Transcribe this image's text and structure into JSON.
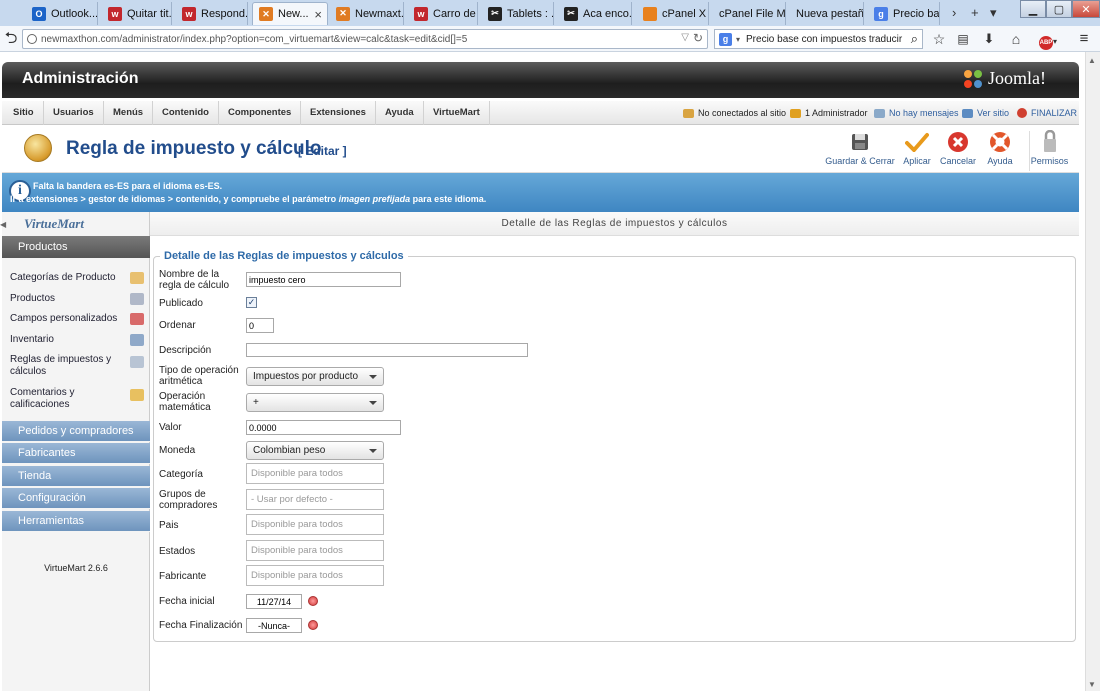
{
  "browser": {
    "tabs": [
      {
        "label": "Outlook...",
        "icon": "outlook-icon",
        "color": "#1c64c8",
        "glyph": "O"
      },
      {
        "label": "Quitar tit...",
        "icon": "bookmark-icon",
        "color": "#c2272d",
        "glyph": "w"
      },
      {
        "label": "Respond...",
        "icon": "bookmark-icon",
        "color": "#c2272d",
        "glyph": "w"
      },
      {
        "label": "New...",
        "icon": "joomla-icon",
        "color": "#e07b22",
        "glyph": "✕",
        "active": true
      },
      {
        "label": "Newmaxt...",
        "icon": "joomla-icon",
        "color": "#e07b22",
        "glyph": "✕"
      },
      {
        "label": "Carro de ...",
        "icon": "bookmark-icon",
        "color": "#c2272d",
        "glyph": "w"
      },
      {
        "label": "Tablets : ...",
        "icon": "scissors-icon",
        "color": "#222",
        "glyph": "✂"
      },
      {
        "label": "Aca enco...",
        "icon": "scissors-icon",
        "color": "#222",
        "glyph": "✂"
      },
      {
        "label": "cPanel X ...",
        "icon": "cpanel-icon",
        "color": "#e8811e",
        "glyph": ""
      },
      {
        "label": "cPanel File M...",
        "icon": "",
        "color": "",
        "glyph": ""
      },
      {
        "label": "Nueva pestaña",
        "icon": "",
        "color": "",
        "glyph": ""
      },
      {
        "label": "Precio ba...",
        "icon": "google-icon",
        "color": "#4a7fe8",
        "glyph": "g"
      }
    ],
    "url": "newmaxthon.com/administrator/index.php?option=com_virtuemart&view=calc&task=edit&cid[]=5",
    "url_host": "newmaxthon.com",
    "search": "Precio base con impuestos traducir"
  },
  "admin": {
    "title": "Administración",
    "logo": "Joomla!",
    "menu": [
      "Sitio",
      "Usuarios",
      "Menús",
      "Contenido",
      "Componentes",
      "Extensiones",
      "Ayuda",
      "VirtueMart"
    ],
    "status": {
      "online": "No conectados al sitio",
      "admins": "1 Administrador",
      "messages": "No hay mensajes",
      "view_site": "Ver sitio",
      "logout": "FINALIZAR"
    }
  },
  "page": {
    "title": "Regla de impuesto y cálculo",
    "edit_tag": "[ Editar ]",
    "toolbar": [
      {
        "label": "Guardar & Cerrar",
        "icon": "save-icon"
      },
      {
        "label": "Aplicar",
        "icon": "apply-icon"
      },
      {
        "label": "Cancelar",
        "icon": "cancel-icon"
      },
      {
        "label": "Ayuda",
        "icon": "help-icon"
      },
      {
        "label": "Permisos",
        "icon": "permissions-icon"
      }
    ],
    "message_line1": "Falta la bandera es-ES para el idioma es-ES.",
    "message_line2_prefix": "Ir a extensiones > gestor de idiomas > contenido, y compruebe el parámetro",
    "message_line2_italic": "imagen prefijada",
    "message_line2_suffix": "para este idioma."
  },
  "sidebar": {
    "logo": "VirtueMart",
    "active_section": "Productos",
    "items": [
      {
        "label": "Categorías de Producto",
        "icon": "categories-icon"
      },
      {
        "label": "Productos",
        "icon": "products-icon"
      },
      {
        "label": "Campos personalizados",
        "icon": "custom-fields-icon"
      },
      {
        "label": "Inventario",
        "icon": "inventory-icon"
      },
      {
        "label": "Reglas de impuestos y cálculos",
        "icon": "tax-rules-icon"
      },
      {
        "label": "Comentarios y calificaciones",
        "icon": "reviews-icon"
      }
    ],
    "sections": [
      "Pedidos y compradores",
      "Fabricantes",
      "Tienda",
      "Configuración",
      "Herramientas"
    ],
    "version": "VirtueMart 2.6.6"
  },
  "form": {
    "tab_label": "Detalle de las Reglas de impuestos y cálculos",
    "legend": "Detalle de las Reglas de impuestos y cálculos",
    "fields": {
      "name": {
        "label": "Nombre de la regla de cálculo",
        "value": "impuesto cero"
      },
      "published": {
        "label": "Publicado",
        "checked": true
      },
      "order": {
        "label": "Ordenar",
        "value": "0"
      },
      "description": {
        "label": "Descripción",
        "value": ""
      },
      "operation_type": {
        "label": "Tipo de operación aritmética",
        "value": "Impuestos por producto"
      },
      "math_op": {
        "label": "Operación matemática",
        "value": "+"
      },
      "value": {
        "label": "Valor",
        "value": "0.0000"
      },
      "currency": {
        "label": "Moneda",
        "value": "Colombian peso"
      },
      "category": {
        "label": "Categoría",
        "placeholder": "Disponible para todos"
      },
      "shopper_groups": {
        "label": "Grupos de compradores",
        "placeholder": "- Usar por defecto -"
      },
      "country": {
        "label": "Pais",
        "placeholder": "Disponible para todos"
      },
      "states": {
        "label": "Estados",
        "placeholder": "Disponible para todos"
      },
      "manufacturer": {
        "label": "Fabricante",
        "placeholder": "Disponible para todos"
      },
      "start_date": {
        "label": "Fecha inicial",
        "value": "11/27/14"
      },
      "end_date": {
        "label": "Fecha Finalización",
        "value": "-Nunca-"
      }
    }
  },
  "colors": {
    "accent": "#2e6aa8",
    "message_bg": "#4a90c8",
    "sidebar_section": "#7fa2c8",
    "title_text": "#224d8c"
  }
}
